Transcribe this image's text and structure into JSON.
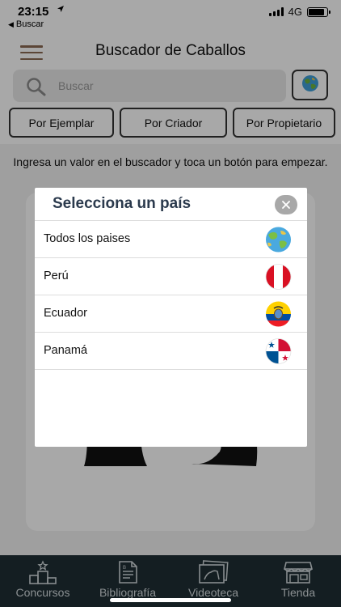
{
  "status_bar": {
    "time": "23:15",
    "location_icon": "location-arrow-icon",
    "back_label": "Buscar",
    "network": "4G",
    "battery_level": 0.85
  },
  "header": {
    "title": "Buscador de Caballos",
    "menu_icon": "hamburger-icon",
    "menu_color": "#8a6a52"
  },
  "search": {
    "placeholder": "Buscar",
    "value": "",
    "icon": "search-icon",
    "country_button_icon": "globe-icon"
  },
  "filters": [
    {
      "label": "Por Ejemplar"
    },
    {
      "label": "Por Criador"
    },
    {
      "label": "Por Propietario"
    }
  ],
  "main": {
    "instructions": "Ingresa un valor en el buscador y toca un botón para empezar."
  },
  "modal": {
    "title": "Selecciona un país",
    "close_icon": "close-icon",
    "countries": [
      {
        "name": "Todos los paises",
        "flag": "globe-flag-icon"
      },
      {
        "name": "Perú",
        "flag": "peru-flag-icon"
      },
      {
        "name": "Ecuador",
        "flag": "ecuador-flag-icon"
      },
      {
        "name": "Panamá",
        "flag": "panama-flag-icon"
      }
    ]
  },
  "tabbar": {
    "background": "#1f2e35",
    "tabs": [
      {
        "label": "Concursos",
        "icon": "podium-icon"
      },
      {
        "label": "Bibliografía",
        "icon": "document-icon"
      },
      {
        "label": "Videoteca",
        "icon": "video-library-icon"
      },
      {
        "label": "Tienda",
        "icon": "store-icon"
      }
    ]
  }
}
